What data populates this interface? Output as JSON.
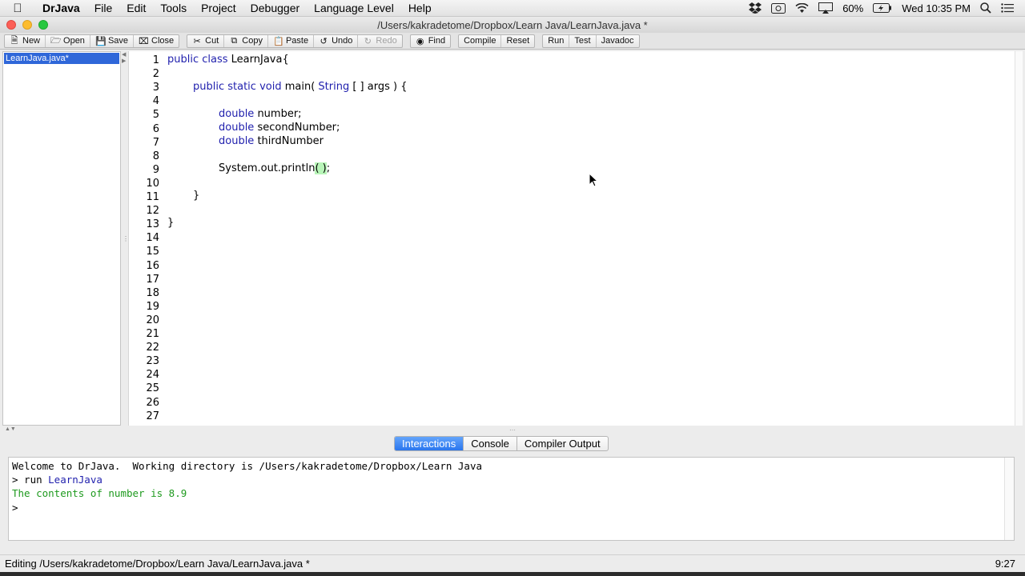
{
  "menubar": {
    "app": "DrJava",
    "items": [
      "File",
      "Edit",
      "Tools",
      "Project",
      "Debugger",
      "Language Level",
      "Help"
    ],
    "battery": "60%",
    "clock": "Wed 10:35 PM"
  },
  "window": {
    "title": "/Users/kakradetome/Dropbox/Learn Java/LearnJava.java *"
  },
  "toolbar": {
    "new": "New",
    "open": "Open",
    "save": "Save",
    "close": "Close",
    "cut": "Cut",
    "copy": "Copy",
    "paste": "Paste",
    "undo": "Undo",
    "redo": "Redo",
    "find": "Find",
    "compile": "Compile",
    "reset": "Reset",
    "run": "Run",
    "test": "Test",
    "javadoc": "Javadoc"
  },
  "files": {
    "open": [
      "LearnJava.java*"
    ]
  },
  "editor": {
    "line_numbers": [
      "1",
      "2",
      "3",
      "4",
      "5",
      "6",
      "7",
      "8",
      "9",
      "10",
      "11",
      "12",
      "13",
      "14",
      "15",
      "16",
      "17",
      "18",
      "19",
      "20",
      "21",
      "22",
      "23",
      "24",
      "25",
      "26",
      "27"
    ],
    "lines": {
      "l1_kw": "public class",
      "l1_rest": " LearnJava{",
      "l3_kw": "public static void",
      "l3_rest": " main( ",
      "l3_type": "String",
      "l3_end": " [ ] args ) {",
      "l5_type": "double",
      "l5_rest": " number;",
      "l6_type": "double",
      "l6_rest": " secondNumber;",
      "l7_type": "double",
      "l7_rest": " thirdNumber",
      "l9_a": "System.out.println",
      "l9_paren_open": "(",
      "l9_space": " ",
      "l9_paren_close": ")",
      "l9_end": ";",
      "l11": "}",
      "l13": "}"
    }
  },
  "tabs": {
    "interactions": "Interactions",
    "console": "Console",
    "compiler_output": "Compiler Output"
  },
  "interactions": {
    "welcome": "Welcome to DrJava.  Working directory is /Users/kakradetome/Dropbox/Learn Java",
    "cmd_prompt": "> run ",
    "cmd_arg": "LearnJava",
    "output": "The contents of number is 8.9",
    "prompt": ">"
  },
  "status": {
    "editing": "Editing /Users/kakradetome/Dropbox/Learn Java/LearnJava.java *",
    "position": "9:27"
  }
}
